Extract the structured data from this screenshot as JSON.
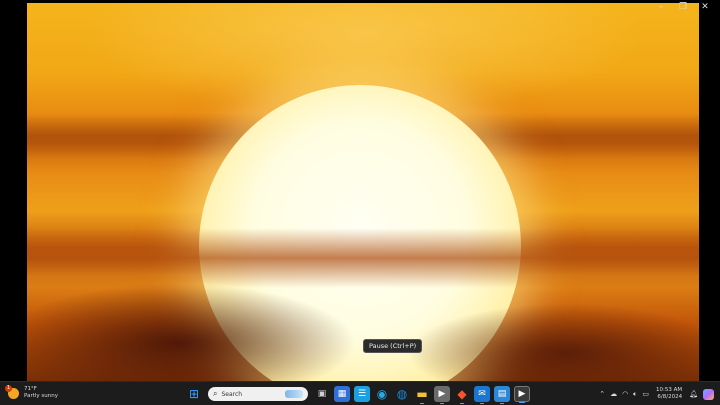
{
  "player": {
    "tooltip": "Pause (Ctrl+P)",
    "window_controls": [
      "–",
      "❐",
      "✕"
    ]
  },
  "taskbar": {
    "weather": {
      "temp": "71°F",
      "desc": "Partly sunny",
      "badge": "1"
    },
    "search": {
      "label": "Search"
    },
    "pinned_apps": [
      {
        "name": "start",
        "glyph": "⊞",
        "color": "#3aa0ff"
      },
      {
        "name": "task-view",
        "glyph": "▣",
        "color": "#cfcfcf"
      },
      {
        "name": "widgets",
        "glyph": "▦",
        "color": "#2f6fd6"
      },
      {
        "name": "news",
        "glyph": "☰",
        "color": "#1ba1e2"
      },
      {
        "name": "edge-beta",
        "glyph": "◉",
        "color": "#2aa8e0"
      },
      {
        "name": "edge",
        "glyph": "◍",
        "color": "#1a8ad4"
      },
      {
        "name": "file-explorer",
        "glyph": "▬",
        "color": "#f3c13a"
      },
      {
        "name": "media",
        "glyph": "▶",
        "color": "#6b6b6b"
      },
      {
        "name": "brave",
        "glyph": "◆",
        "color": "#fb542b"
      },
      {
        "name": "mail",
        "glyph": "✉",
        "color": "#1976d2"
      },
      {
        "name": "calendar",
        "glyph": "▤",
        "color": "#2b88d8"
      },
      {
        "name": "media-player",
        "glyph": "▶",
        "color": "#3a3a3a"
      }
    ],
    "tray": {
      "chevron": "⌃",
      "clock_time": "10:53 AM",
      "clock_date": "6/8/2024"
    }
  }
}
